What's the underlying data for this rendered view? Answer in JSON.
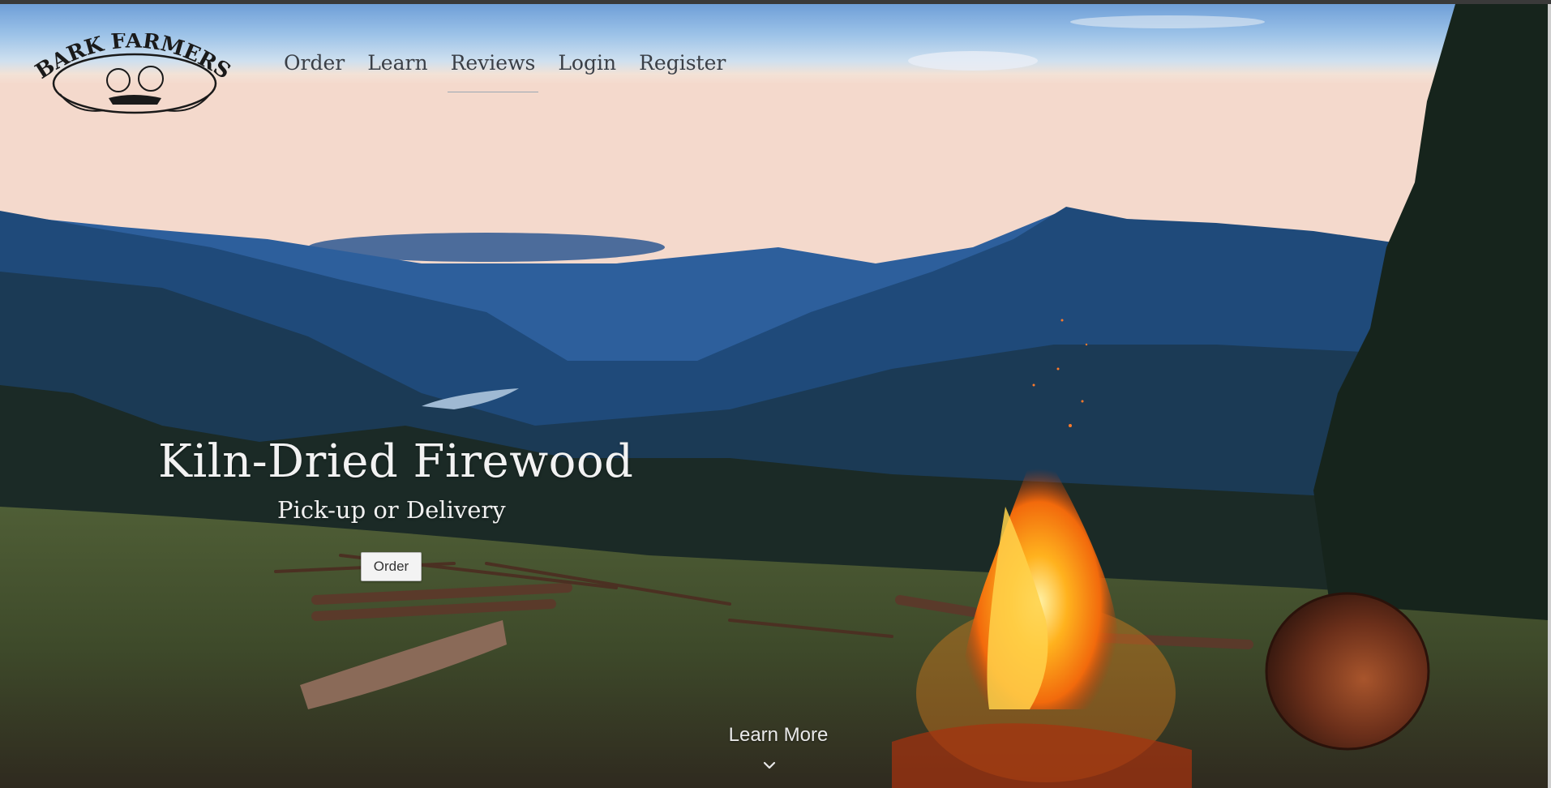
{
  "brand": {
    "logo_text": "BARK FARMERS"
  },
  "nav": {
    "items": [
      {
        "label": "Order"
      },
      {
        "label": "Learn"
      },
      {
        "label": "Reviews"
      },
      {
        "label": "Login"
      },
      {
        "label": "Register"
      }
    ],
    "active": "Reviews"
  },
  "hero": {
    "title": "Kiln-Dried Firewood",
    "subtitle": "Pick-up or Delivery",
    "order_button": "Order",
    "learn_more": "Learn More",
    "learn_more_icon": "chevron-down-icon"
  },
  "colors": {
    "nav_text": "#3a3f47",
    "hero_text": "#f2f2f2",
    "button_bg": "#f3f3f3"
  }
}
